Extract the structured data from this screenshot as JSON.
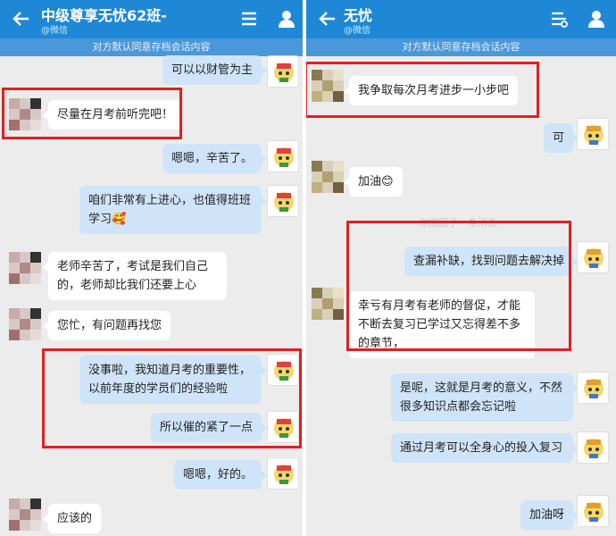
{
  "left": {
    "title": "中级尊享无忧62班-",
    "subtitle": "@微信",
    "notice": "对方默认同意存档会话内容",
    "messages": [
      {
        "side": "out",
        "text": "可以以财管为主"
      },
      {
        "side": "in",
        "text": "尽量在月考前听完吧！"
      },
      {
        "side": "out",
        "text": "嗯嗯，辛苦了。"
      },
      {
        "side": "out",
        "text": "咱们非常有上进心，也值得班班学习🥰"
      },
      {
        "side": "in",
        "text": "老师辛苦了，考试是我们自己的，老师却比我们还要上心"
      },
      {
        "side": "in",
        "text": "您忙，有问题再找您"
      },
      {
        "side": "out",
        "text": "没事啦，我知道月考的重要性，以前年度的学员们的经验啦"
      },
      {
        "side": "out",
        "text": "所以催的紧了一点"
      },
      {
        "side": "out",
        "text": "嗯嗯，好的。"
      },
      {
        "side": "in",
        "text": "应该的"
      }
    ]
  },
  "right": {
    "title": "无忧",
    "subtitle": "@微信",
    "notice": "对方默认同意存档会话内容",
    "recall": "你撤回了一条消息",
    "messages": [
      {
        "side": "in",
        "text": "我争取每次月考进步一小步吧"
      },
      {
        "side": "out",
        "text": "可"
      },
      {
        "side": "in",
        "text": "加油😊"
      },
      {
        "side": "out",
        "text": "查漏补缺，找到问题去解决掉"
      },
      {
        "side": "in",
        "text": "幸亏有月考有老师的督促，才能不断去复习已学过又忘得差不多的章节，"
      },
      {
        "side": "out",
        "text": "是呢，这就是月考的意义，不然很多知识点都会忘记啦"
      },
      {
        "side": "out",
        "text": "通过月考可以全身心的投入复习"
      },
      {
        "side": "out",
        "text": "加油呀"
      }
    ]
  },
  "colors": {
    "titlebar": "#1f88d6",
    "notice": "#4a97d9",
    "highlight": "#e02020",
    "out_bubble": "#cfe4f8"
  },
  "icons": [
    "back-arrow-icon",
    "menu-icon",
    "person-icon",
    "settings-icon"
  ]
}
